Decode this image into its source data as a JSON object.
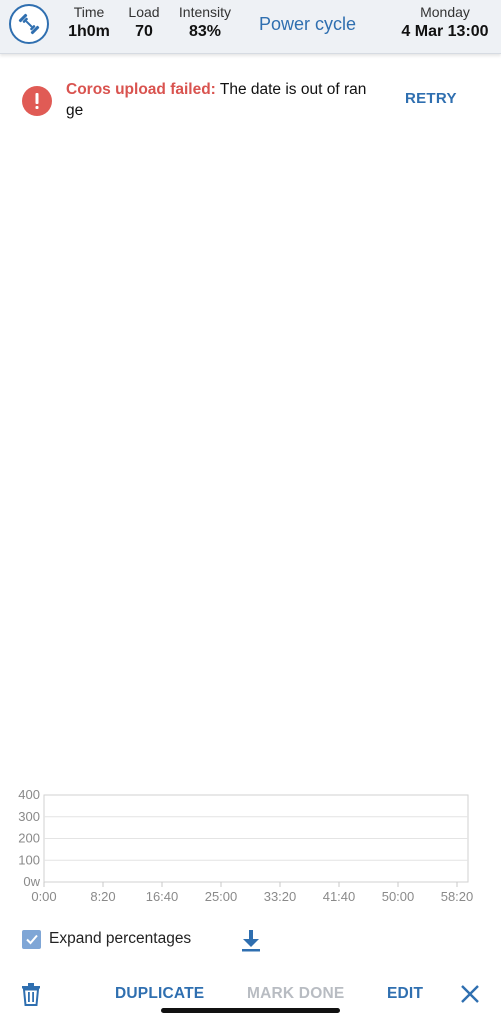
{
  "header": {
    "logo_icon": "dumbbell-icon",
    "stats": [
      {
        "label": "Time",
        "value": "1h0m"
      },
      {
        "label": "Load",
        "value": "70"
      },
      {
        "label": "Intensity",
        "value": "83%"
      }
    ],
    "title": "Power cycle",
    "day": "Monday",
    "datetime": "4 Mar 13:00"
  },
  "alert": {
    "icon": "exclamation-icon",
    "title": "Coros upload failed:",
    "message": " The date is out of range",
    "action": "RETRY"
  },
  "chart_data": {
    "type": "line",
    "title": "",
    "xlabel": "",
    "ylabel": "",
    "x_ticks": [
      "0:00",
      "8:20",
      "16:40",
      "25:00",
      "33:20",
      "41:40",
      "50:00",
      "58:20"
    ],
    "y_ticks": [
      "0w",
      "100",
      "200",
      "300",
      "400"
    ],
    "ylim": [
      0,
      400
    ],
    "grid": true,
    "series": []
  },
  "options": {
    "expand_percentages_label": "Expand percentages",
    "expand_percentages_checked": true,
    "download_icon": "download-icon"
  },
  "actions": {
    "delete_icon": "trash-icon",
    "duplicate": "DUPLICATE",
    "mark_done": "MARK DONE",
    "edit": "EDIT",
    "close_icon": "close-icon"
  },
  "colors": {
    "accent": "#2f6fb0",
    "error": "#d9534f",
    "disabled": "#b8bcc2",
    "header_bg": "#eef1f5"
  }
}
